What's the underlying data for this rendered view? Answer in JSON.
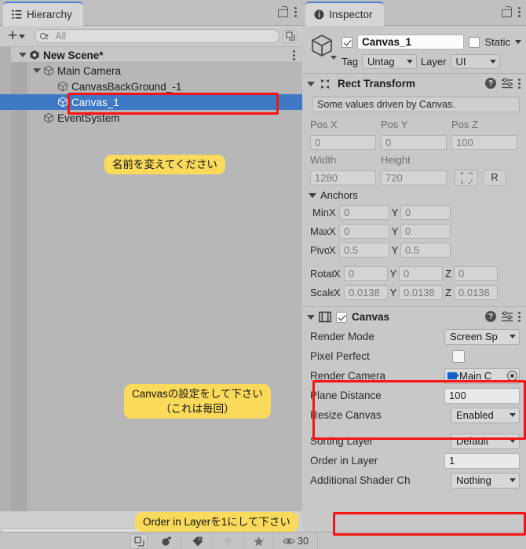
{
  "hierarchy": {
    "tab_label": "Hierarchy",
    "tab_icon": "hierarchy-list-icon",
    "lock_icon": "lock-open-icon",
    "menu_icon": "kebab-menu-icon",
    "add_button": "+",
    "search": {
      "value": "All",
      "icon": "search-icon"
    },
    "advanced_search_icon": "expand-search-icon",
    "tree": [
      {
        "label": "New Scene*",
        "icon": "unity-scene-icon",
        "depth": 0,
        "expanded": true,
        "selected": false,
        "bold": true
      },
      {
        "label": "Main Camera",
        "icon": "gameobject-cube-icon",
        "depth": 1,
        "expanded": true,
        "selected": false,
        "bold": false
      },
      {
        "label": "CanvasBackGround_-1",
        "icon": "gameobject-cube-icon",
        "depth": 2,
        "expanded": false,
        "selected": false,
        "bold": false
      },
      {
        "label": "Canvas_1",
        "icon": "gameobject-cube-icon",
        "depth": 2,
        "expanded": false,
        "selected": true,
        "bold": false
      },
      {
        "label": "EventSystem",
        "icon": "gameobject-cube-icon",
        "depth": 1,
        "expanded": false,
        "selected": false,
        "bold": false
      }
    ]
  },
  "inspector": {
    "tab_label": "Inspector",
    "tab_icon": "info-circle-icon",
    "lock_icon": "lock-open-icon",
    "menu_icon": "kebab-menu-icon",
    "object": {
      "icon": "gameobject-cube-icon",
      "enabled": true,
      "name": "Canvas_1",
      "static_checked": false,
      "static_label": "Static",
      "tag_label": "Tag",
      "tag_value": "Untag",
      "layer_label": "Layer",
      "layer_value": "UI"
    },
    "rect_transform": {
      "title": "Rect Transform",
      "anchor_preset_icon": "anchor-preset-icon",
      "help_icon": "help-icon",
      "preset_icon": "preset-settings-icon",
      "menu_icon": "kebab-menu-icon",
      "info": "Some values driven by Canvas.",
      "pos_labels": [
        "Pos X",
        "Pos Y",
        "Pos Z"
      ],
      "pos_values": [
        "0",
        "0",
        "100"
      ],
      "size_labels": [
        "Width",
        "Height"
      ],
      "size_values": [
        "1280",
        "720"
      ],
      "blueprint_icon": "blueprint-mode-icon",
      "raw_button": "R",
      "anchors_label": "Anchors",
      "anchor_min": {
        "name": "Min",
        "x_label": "X",
        "x": "0",
        "y_label": "Y",
        "y": "0"
      },
      "anchor_max": {
        "name": "Max",
        "x_label": "X",
        "x": "0",
        "y_label": "Y",
        "y": "0"
      },
      "pivot": {
        "name": "Pivot",
        "x_label": "X",
        "x": "0.5",
        "y_label": "Y",
        "y": "0.5"
      },
      "rotation": {
        "name": "Rotation",
        "x_label": "X",
        "x": "0",
        "y_label": "Y",
        "y": "0",
        "z_label": "Z",
        "z": "0"
      },
      "scale": {
        "name": "Scale",
        "x_label": "X",
        "x": "0.0138",
        "y_label": "Y",
        "y": "0.0138",
        "z_label": "Z",
        "z": "0.0138"
      }
    },
    "canvas": {
      "title": "Canvas",
      "icon": "canvas-component-icon",
      "enabled": true,
      "help_icon": "help-icon",
      "preset_icon": "preset-settings-icon",
      "menu_icon": "kebab-menu-icon",
      "rows": [
        {
          "label": "Render Mode",
          "value": "Screen Sp",
          "type": "dropdown"
        },
        {
          "label": "Pixel Perfect",
          "value": "",
          "type": "checkbox",
          "checked": false
        },
        {
          "label": "Render Camera",
          "value": "Main C",
          "type": "object",
          "icon": "camera-icon"
        },
        {
          "label": "Plane Distance",
          "value": "100",
          "type": "text"
        },
        {
          "label": "Resize Canvas",
          "value": "Enabled",
          "type": "dropdown"
        },
        {
          "label": "Sorting Layer",
          "value": "Default",
          "type": "dropdown"
        },
        {
          "label": "Order in Layer",
          "value": "1",
          "type": "text"
        },
        {
          "label": "Additional Shader Ch",
          "value": "Nothing",
          "type": "dropdown"
        }
      ]
    }
  },
  "annotations": [
    {
      "id": "note-rename",
      "lines": [
        "名前を変えてください"
      ]
    },
    {
      "id": "note-canvas-settings",
      "lines": [
        "Canvasの設定をして下さい",
        "（これは毎回）"
      ]
    },
    {
      "id": "note-order-in-layer",
      "lines": [
        "Order in Layerを1にして下さい"
      ]
    }
  ],
  "status_bar": {
    "icons": [
      "paint-bucket-icon",
      "tag-icon",
      "light-icon",
      "star-icon",
      "eye-icon"
    ],
    "count": "30",
    "left_icon": "expand-window-icon"
  },
  "colors": {
    "selection_blue": "#3f79c6",
    "annotation_red": "#f81313",
    "note_yellow": "#fada5a",
    "panel_gray": "#c8c8c8"
  }
}
